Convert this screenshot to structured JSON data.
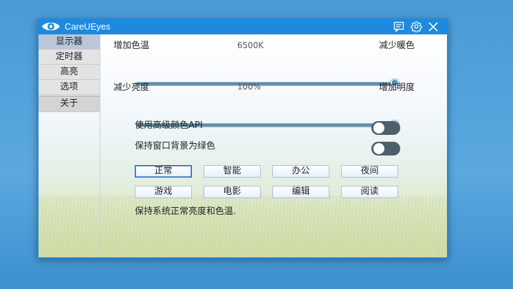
{
  "window": {
    "title": "CareUEyes"
  },
  "sidebar": {
    "items": [
      {
        "label": "显示器"
      },
      {
        "label": "定时器"
      },
      {
        "label": "高亮"
      },
      {
        "label": "选项"
      },
      {
        "label": "关于"
      }
    ]
  },
  "color_temp": {
    "left_label": "增加色温",
    "value_text": "6500K",
    "right_label": "减少暖色",
    "fraction": 1.0
  },
  "brightness": {
    "left_label": "减少亮度",
    "value_text": "100%",
    "right_label": "增加明度",
    "fraction": 1.0
  },
  "toggles": {
    "advanced_api": {
      "label": "使用高级颜色API",
      "on": false
    },
    "green_bg": {
      "label": "保持窗口背景为绿色",
      "on": false
    }
  },
  "presets": {
    "row1": [
      "正常",
      "智能",
      "办公",
      "夜间"
    ],
    "row2": [
      "游戏",
      "电影",
      "编辑",
      "阅读"
    ],
    "selected": "正常"
  },
  "description": "保持系统正常亮度和色温.",
  "colors": {
    "titlebar": "#1d8ae0",
    "accent": "#1b4fd6",
    "toggle_off": "#4f5e6b"
  }
}
